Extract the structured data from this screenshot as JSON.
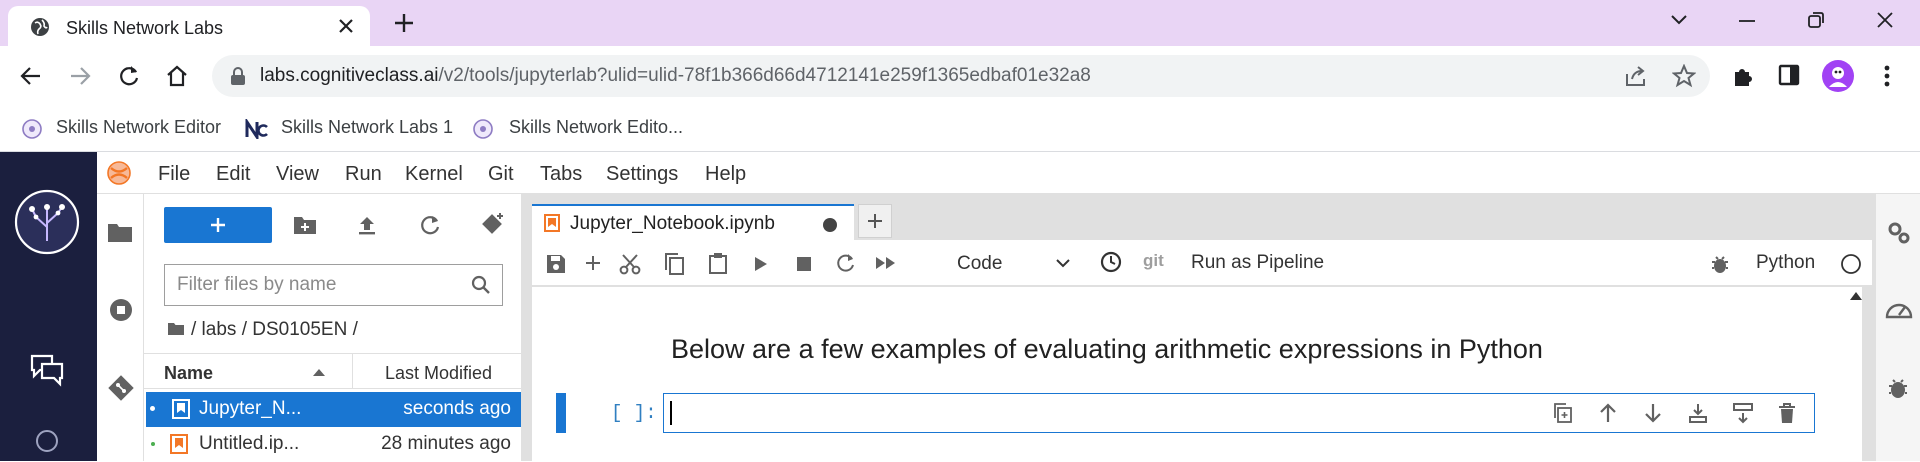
{
  "browser": {
    "tab_title": "Skills Network Labs",
    "url_host": "labs.cognitiveclass.ai",
    "url_path": "/v2/tools/jupyterlab?ulid=ulid-78f1b366d66d4712141e259f1365edbaf01e32a8",
    "bookmarks": [
      {
        "label": "Skills Network Editor",
        "icon": "skills-network-icon"
      },
      {
        "label": "Skills Network Labs 1",
        "icon": "nc-logo-icon"
      },
      {
        "label": "Skills Network Edito...",
        "icon": "skills-network-icon"
      }
    ]
  },
  "menubar": {
    "items": [
      "File",
      "Edit",
      "View",
      "Run",
      "Kernel",
      "Git",
      "Tabs",
      "Settings",
      "Help"
    ]
  },
  "filebrowser": {
    "filter_placeholder": "Filter files by name",
    "breadcrumb": "/ labs / DS0105EN /",
    "col_name": "Name",
    "col_modified": "Last Modified",
    "files": [
      {
        "name": "Jupyter_N...",
        "modified": "seconds ago",
        "selected": true,
        "type": "notebook"
      },
      {
        "name": "Untitled.ip...",
        "modified": "28 minutes ago",
        "selected": false,
        "type": "notebook"
      }
    ]
  },
  "notebook": {
    "tab_title": "Jupyter_Notebook.ipynb",
    "cell_type": "Code",
    "git_label": "git",
    "pipeline_label": "Run as Pipeline",
    "kernel_name": "Python",
    "heading": "Below are a few examples of evaluating arithmetic expressions in Python",
    "prompt": "[ ]:"
  },
  "colors": {
    "accent": "#1976d2",
    "tabstrip": "#e9d5f5",
    "leftbar": "#1b1f3e",
    "notebook_orange": "#f37726"
  }
}
